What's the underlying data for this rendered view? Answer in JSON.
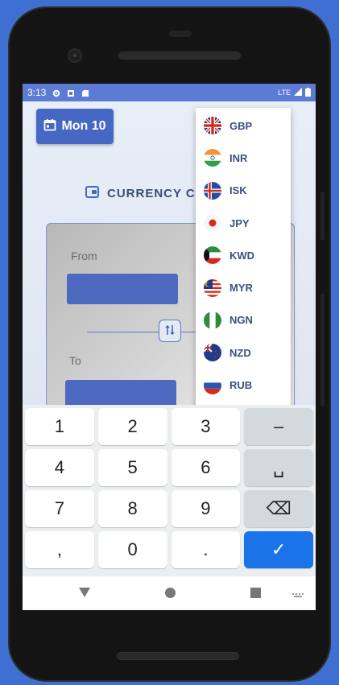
{
  "status_bar": {
    "time": "3:13",
    "network": "LTE"
  },
  "header": {
    "date_button_label": "Mon 10"
  },
  "title": {
    "text": "CURRENCY CO"
  },
  "converter": {
    "from_label": "From",
    "to_label": "To"
  },
  "dropdown": {
    "items": [
      {
        "code": "GBP",
        "flag": "uk-flag-icon"
      },
      {
        "code": "INR",
        "flag": "india-flag-icon"
      },
      {
        "code": "ISK",
        "flag": "iceland-flag-icon"
      },
      {
        "code": "JPY",
        "flag": "japan-flag-icon"
      },
      {
        "code": "KWD",
        "flag": "kuwait-flag-icon"
      },
      {
        "code": "MYR",
        "flag": "malaysia-flag-icon"
      },
      {
        "code": "NGN",
        "flag": "nigeria-flag-icon"
      },
      {
        "code": "NZD",
        "flag": "new-zealand-flag-icon"
      },
      {
        "code": "RUB",
        "flag": "russia-flag-icon"
      }
    ]
  },
  "keyboard": {
    "rows": [
      [
        "1",
        "2",
        "3",
        "–"
      ],
      [
        "4",
        "5",
        "6",
        "␣"
      ],
      [
        "7",
        "8",
        "9",
        "⌫"
      ],
      [
        ",",
        "0",
        ".",
        "✓"
      ]
    ]
  },
  "colors": {
    "accent": "#4667c3",
    "status_bar": "#5b7bd4",
    "confirm_key": "#1a73e8",
    "currency_text": "#3d4f7e"
  }
}
